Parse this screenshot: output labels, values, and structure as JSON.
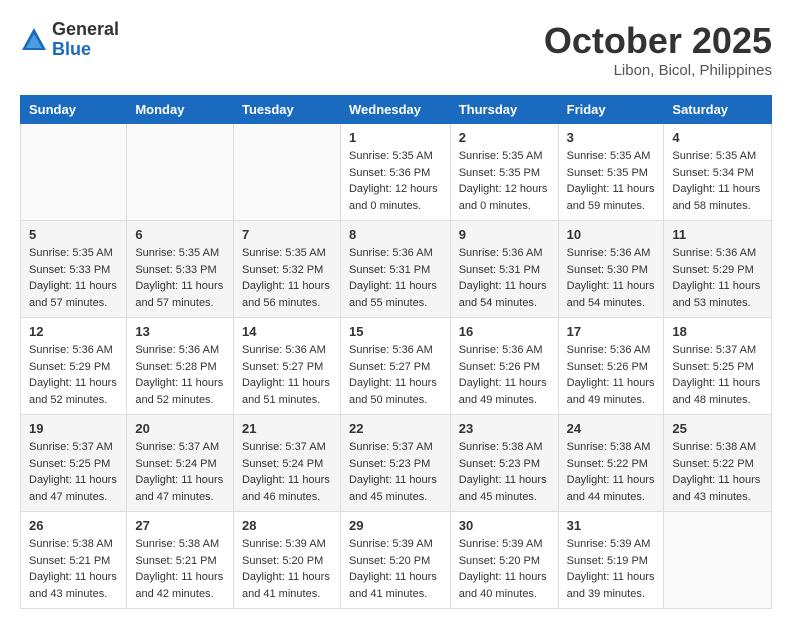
{
  "logo": {
    "general": "General",
    "blue": "Blue"
  },
  "header": {
    "month": "October 2025",
    "location": "Libon, Bicol, Philippines"
  },
  "weekdays": [
    "Sunday",
    "Monday",
    "Tuesday",
    "Wednesday",
    "Thursday",
    "Friday",
    "Saturday"
  ],
  "weeks": [
    [
      {
        "day": "",
        "info": ""
      },
      {
        "day": "",
        "info": ""
      },
      {
        "day": "",
        "info": ""
      },
      {
        "day": "1",
        "info": "Sunrise: 5:35 AM\nSunset: 5:36 PM\nDaylight: 12 hours\nand 0 minutes."
      },
      {
        "day": "2",
        "info": "Sunrise: 5:35 AM\nSunset: 5:35 PM\nDaylight: 12 hours\nand 0 minutes."
      },
      {
        "day": "3",
        "info": "Sunrise: 5:35 AM\nSunset: 5:35 PM\nDaylight: 11 hours\nand 59 minutes."
      },
      {
        "day": "4",
        "info": "Sunrise: 5:35 AM\nSunset: 5:34 PM\nDaylight: 11 hours\nand 58 minutes."
      }
    ],
    [
      {
        "day": "5",
        "info": "Sunrise: 5:35 AM\nSunset: 5:33 PM\nDaylight: 11 hours\nand 57 minutes."
      },
      {
        "day": "6",
        "info": "Sunrise: 5:35 AM\nSunset: 5:33 PM\nDaylight: 11 hours\nand 57 minutes."
      },
      {
        "day": "7",
        "info": "Sunrise: 5:35 AM\nSunset: 5:32 PM\nDaylight: 11 hours\nand 56 minutes."
      },
      {
        "day": "8",
        "info": "Sunrise: 5:36 AM\nSunset: 5:31 PM\nDaylight: 11 hours\nand 55 minutes."
      },
      {
        "day": "9",
        "info": "Sunrise: 5:36 AM\nSunset: 5:31 PM\nDaylight: 11 hours\nand 54 minutes."
      },
      {
        "day": "10",
        "info": "Sunrise: 5:36 AM\nSunset: 5:30 PM\nDaylight: 11 hours\nand 54 minutes."
      },
      {
        "day": "11",
        "info": "Sunrise: 5:36 AM\nSunset: 5:29 PM\nDaylight: 11 hours\nand 53 minutes."
      }
    ],
    [
      {
        "day": "12",
        "info": "Sunrise: 5:36 AM\nSunset: 5:29 PM\nDaylight: 11 hours\nand 52 minutes."
      },
      {
        "day": "13",
        "info": "Sunrise: 5:36 AM\nSunset: 5:28 PM\nDaylight: 11 hours\nand 52 minutes."
      },
      {
        "day": "14",
        "info": "Sunrise: 5:36 AM\nSunset: 5:27 PM\nDaylight: 11 hours\nand 51 minutes."
      },
      {
        "day": "15",
        "info": "Sunrise: 5:36 AM\nSunset: 5:27 PM\nDaylight: 11 hours\nand 50 minutes."
      },
      {
        "day": "16",
        "info": "Sunrise: 5:36 AM\nSunset: 5:26 PM\nDaylight: 11 hours\nand 49 minutes."
      },
      {
        "day": "17",
        "info": "Sunrise: 5:36 AM\nSunset: 5:26 PM\nDaylight: 11 hours\nand 49 minutes."
      },
      {
        "day": "18",
        "info": "Sunrise: 5:37 AM\nSunset: 5:25 PM\nDaylight: 11 hours\nand 48 minutes."
      }
    ],
    [
      {
        "day": "19",
        "info": "Sunrise: 5:37 AM\nSunset: 5:25 PM\nDaylight: 11 hours\nand 47 minutes."
      },
      {
        "day": "20",
        "info": "Sunrise: 5:37 AM\nSunset: 5:24 PM\nDaylight: 11 hours\nand 47 minutes."
      },
      {
        "day": "21",
        "info": "Sunrise: 5:37 AM\nSunset: 5:24 PM\nDaylight: 11 hours\nand 46 minutes."
      },
      {
        "day": "22",
        "info": "Sunrise: 5:37 AM\nSunset: 5:23 PM\nDaylight: 11 hours\nand 45 minutes."
      },
      {
        "day": "23",
        "info": "Sunrise: 5:38 AM\nSunset: 5:23 PM\nDaylight: 11 hours\nand 45 minutes."
      },
      {
        "day": "24",
        "info": "Sunrise: 5:38 AM\nSunset: 5:22 PM\nDaylight: 11 hours\nand 44 minutes."
      },
      {
        "day": "25",
        "info": "Sunrise: 5:38 AM\nSunset: 5:22 PM\nDaylight: 11 hours\nand 43 minutes."
      }
    ],
    [
      {
        "day": "26",
        "info": "Sunrise: 5:38 AM\nSunset: 5:21 PM\nDaylight: 11 hours\nand 43 minutes."
      },
      {
        "day": "27",
        "info": "Sunrise: 5:38 AM\nSunset: 5:21 PM\nDaylight: 11 hours\nand 42 minutes."
      },
      {
        "day": "28",
        "info": "Sunrise: 5:39 AM\nSunset: 5:20 PM\nDaylight: 11 hours\nand 41 minutes."
      },
      {
        "day": "29",
        "info": "Sunrise: 5:39 AM\nSunset: 5:20 PM\nDaylight: 11 hours\nand 41 minutes."
      },
      {
        "day": "30",
        "info": "Sunrise: 5:39 AM\nSunset: 5:20 PM\nDaylight: 11 hours\nand 40 minutes."
      },
      {
        "day": "31",
        "info": "Sunrise: 5:39 AM\nSunset: 5:19 PM\nDaylight: 11 hours\nand 39 minutes."
      },
      {
        "day": "",
        "info": ""
      }
    ]
  ]
}
